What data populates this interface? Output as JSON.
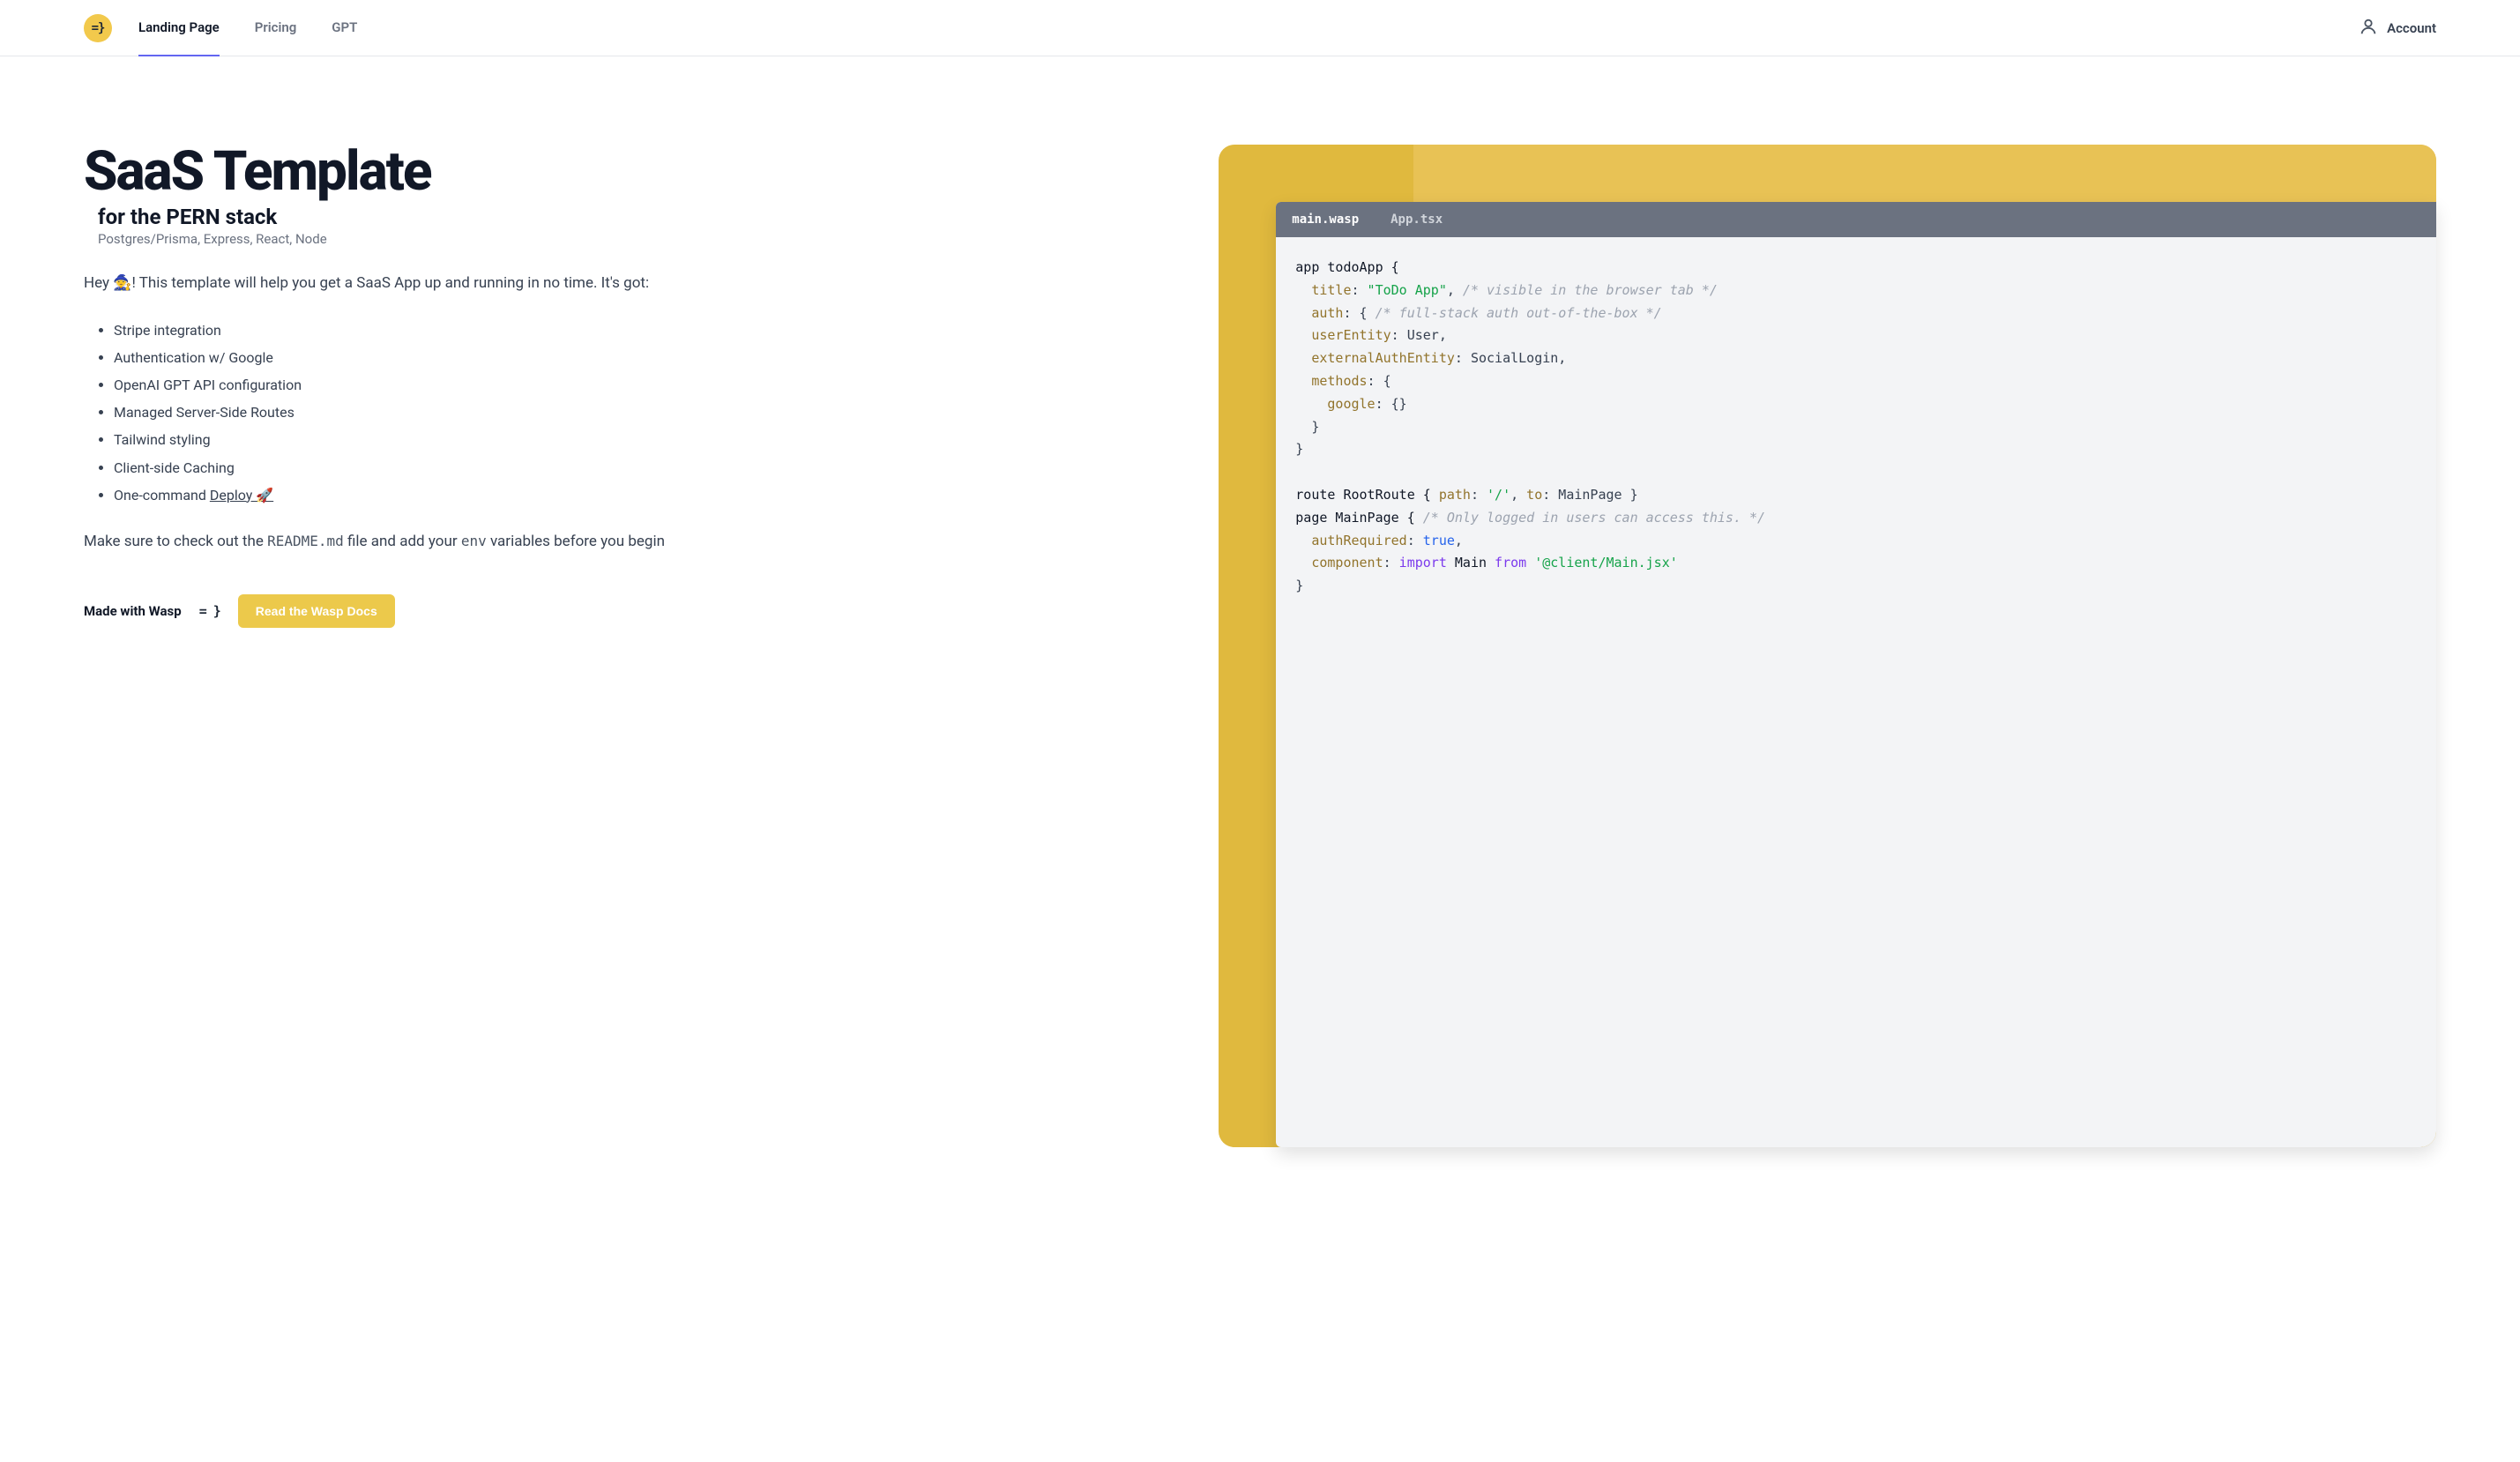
{
  "nav": {
    "logo_text": "=}",
    "tabs": [
      {
        "label": "Landing Page",
        "active": true
      },
      {
        "label": "Pricing",
        "active": false
      },
      {
        "label": "GPT",
        "active": false
      }
    ],
    "account_label": "Account"
  },
  "hero": {
    "title": "SaaS Template",
    "subtitle": "for the PERN stack",
    "stackline": "Postgres/Prisma, Express, React, Node",
    "intro_prefix": "Hey ",
    "intro_emoji": "🧙",
    "intro_rest": "! This template will help you get a SaaS App up and running in no time. It's got:",
    "features": [
      "Stripe integration",
      "Authentication w/ Google",
      "OpenAI GPT API configuration",
      "Managed Server-Side Routes",
      "Tailwind styling",
      "Client-side Caching"
    ],
    "deploy_prefix": "One-command ",
    "deploy_link_text": "Deploy 🚀",
    "outro_a": "Make sure to check out the ",
    "outro_code_a": "README.md",
    "outro_b": " file and add your ",
    "outro_code_b": "env",
    "outro_c": " variables before you begin",
    "made_with": "Made with Wasp",
    "wasp_mark": "= }",
    "docs_button": "Read the Wasp Docs"
  },
  "code": {
    "tabs": [
      {
        "label": "main.wasp",
        "active": true
      },
      {
        "label": "App.tsx",
        "active": false
      }
    ],
    "l01_a": "app todoApp {",
    "l02_key": "title",
    "l02_colon": ": ",
    "l02_str": "\"ToDo App\"",
    "l02_comma": ",",
    "l02_com": " /* visible in the browser tab */",
    "l03_key": "auth",
    "l03_rest": ": { ",
    "l03_com": "/* full-stack auth out-of-the-box */",
    "l04_key": "userEntity",
    "l04_rest": ": User,",
    "l05_key": "externalAuthEntity",
    "l05_rest": ": SocialLogin,",
    "l06_key": "methods",
    "l06_rest": ": {",
    "l07_key": "google",
    "l07_rest": ": {}",
    "l08": "  }",
    "l09": "}",
    "l11_a": "route RootRoute { ",
    "l11_path_key": "path",
    "l11_path_rest": ": ",
    "l11_path_str": "'/'",
    "l11_mid": ", ",
    "l11_to_key": "to",
    "l11_to_rest": ": MainPage }",
    "l12_a": "page MainPage { ",
    "l12_com": "/* Only logged in users can access this. */",
    "l13_key": "authRequired",
    "l13_rest": ": ",
    "l13_bool": "true",
    "l13_comma": ",",
    "l14_key": "component",
    "l14_rest": ": ",
    "l14_import": "import",
    "l14_main": " Main ",
    "l14_from": "from",
    "l14_space": " ",
    "l14_str": "'@client/Main.jsx'",
    "l15": "}"
  },
  "colors": {
    "accent": "#ecc94b",
    "window_a": "#e0b93e",
    "window_b": "#e8c255",
    "tabbar": "#6b7280",
    "active_tab_underline": "#6366f1"
  }
}
